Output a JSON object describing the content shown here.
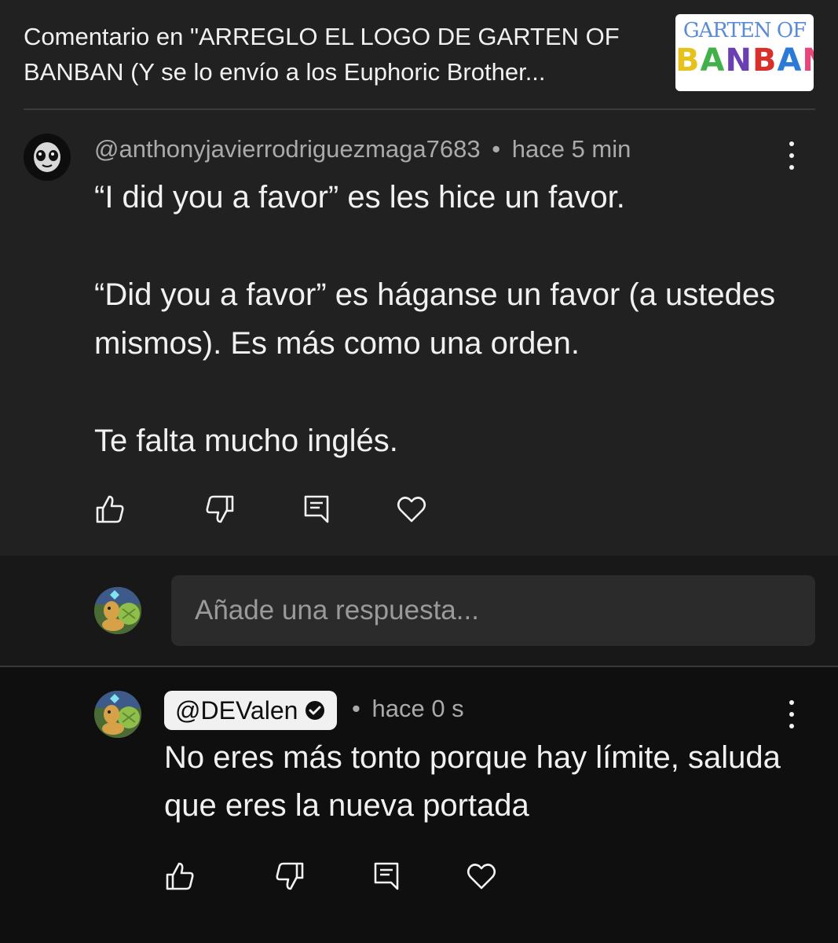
{
  "header": {
    "title": "Comentario en \"ARREGLO EL LOGO DE GARTEN OF BANBAN (Y se lo envío a los Euphoric Brother...",
    "thumbnail": {
      "top_text": "GARTEN OF",
      "bottom_text": "BANBAN",
      "letters": [
        "B",
        "A",
        "N",
        "B",
        "A",
        "N"
      ],
      "letter_colors": [
        "#e8c21c",
        "#43b14b",
        "#6a3fb4",
        "#d9302c",
        "#2a7ad6",
        "#e8457a"
      ]
    }
  },
  "comment": {
    "author": "@anthonyjavierrodriguezmaga7683",
    "separator": "•",
    "time": "hace 5 min",
    "paragraphs": [
      "“I did you a favor” es les hice un favor.",
      "“Did you a favor” es háganse un favor (a ustedes mismos). Es más como una orden.",
      "Te falta mucho inglés."
    ],
    "menu_icon": "more-vertical-icon",
    "actions": [
      "thumbs-up-icon",
      "thumbs-down-icon",
      "reply-icon",
      "heart-icon"
    ]
  },
  "reply_box": {
    "placeholder": "Añade una respuesta..."
  },
  "reply": {
    "author": "@DEValen",
    "verified_icon": "verified-check-icon",
    "separator": "•",
    "time": "hace 0 s",
    "text": "No eres más tonto porque hay límite, saluda que eres la nueva portada",
    "menu_icon": "more-vertical-icon",
    "actions": [
      "thumbs-up-icon",
      "thumbs-down-icon",
      "reply-icon",
      "heart-icon"
    ]
  },
  "colors": {
    "panel_bg": "#212121",
    "page_bg": "#0f0f0f",
    "text_primary": "#f1f1f1",
    "text_secondary": "#aaaaaa",
    "input_bg": "#2b2b2b"
  }
}
